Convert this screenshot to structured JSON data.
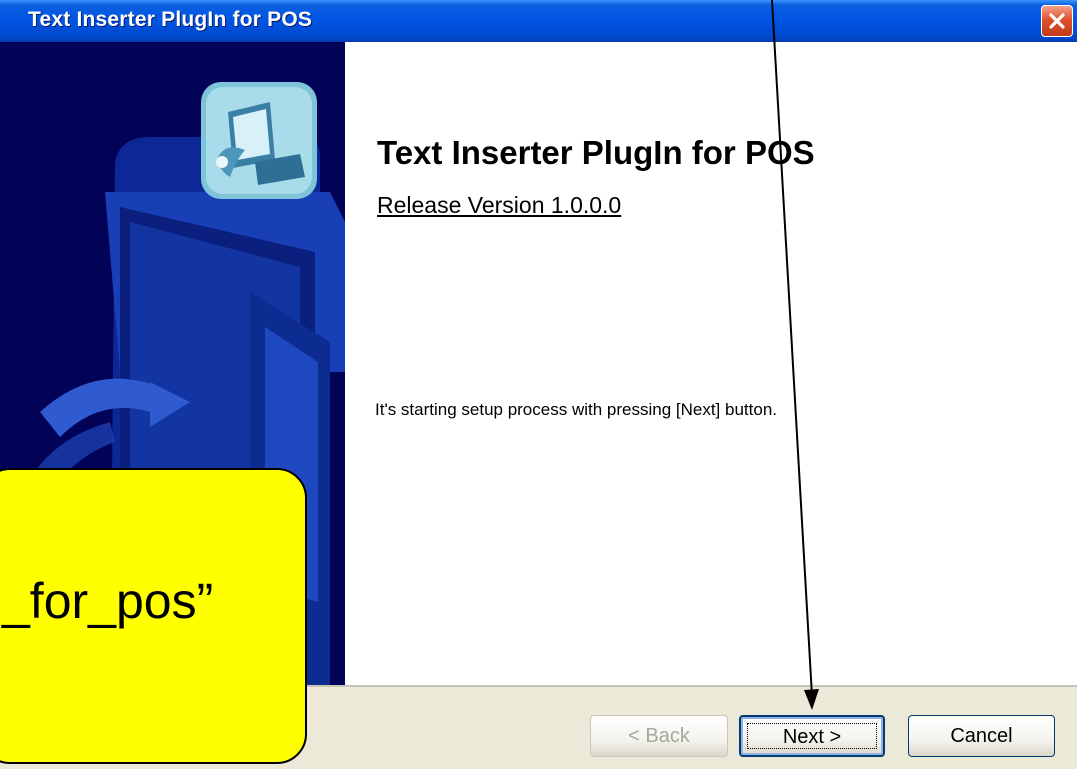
{
  "window": {
    "title": "Text Inserter PlugIn for POS"
  },
  "content": {
    "heading": "Text Inserter PlugIn for POS",
    "version": "Release Version 1.0.0.0",
    "instruction": "It's starting setup process with pressing [Next] button."
  },
  "buttons": {
    "back": "< Back",
    "next": "Next >",
    "cancel": "Cancel"
  },
  "callout": {
    "text": "_for_pos”"
  },
  "icons": {
    "close": "close-icon",
    "setup": "setup-computer-icon"
  },
  "colors": {
    "titlebar": "#0054e3",
    "sidebar": "#020257",
    "callout": "#ffff00",
    "close": "#e0502d"
  }
}
